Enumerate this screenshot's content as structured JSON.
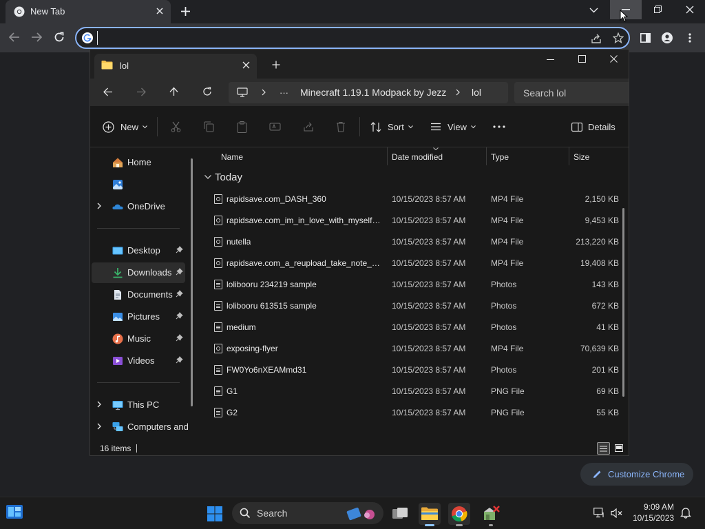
{
  "chrome": {
    "tab_title": "New Tab",
    "omnibox_value": "",
    "customize_label": "Customize Chrome"
  },
  "explorer": {
    "tab_title": "lol",
    "breadcrumb": [
      "Minecraft 1.19.1 Modpack by Jezz",
      "lol"
    ],
    "search_placeholder": "Search lol",
    "commands": {
      "new": "New",
      "sort": "Sort",
      "view": "View",
      "details": "Details"
    },
    "nav": {
      "home": "Home",
      "onedrive": "OneDrive",
      "desktop": "Desktop",
      "downloads": "Downloads",
      "documents": "Documents",
      "pictures": "Pictures",
      "music": "Music",
      "videos": "Videos",
      "this_pc": "This PC",
      "computers": "Computers and"
    },
    "columns": {
      "name": "Name",
      "date": "Date modified",
      "type": "Type",
      "size": "Size"
    },
    "group": "Today",
    "files": [
      {
        "name": "rapidsave.com_DASH_360",
        "date": "10/15/2023 8:57 AM",
        "type": "MP4 File",
        "size": "2,150 KB",
        "kind": "video"
      },
      {
        "name": "rapidsave.com_im_in_love_with_myself-...",
        "date": "10/15/2023 8:57 AM",
        "type": "MP4 File",
        "size": "9,453 KB",
        "kind": "video"
      },
      {
        "name": "nutella",
        "date": "10/15/2023 8:57 AM",
        "type": "MP4 File",
        "size": "213,220 KB",
        "kind": "video"
      },
      {
        "name": "rapidsave.com_a_reupload_take_note_thi...",
        "date": "10/15/2023 8:57 AM",
        "type": "MP4 File",
        "size": "19,408 KB",
        "kind": "video"
      },
      {
        "name": "lolibooru 234219 sample",
        "date": "10/15/2023 8:57 AM",
        "type": "Photos",
        "size": "143 KB",
        "kind": "image"
      },
      {
        "name": "lolibooru 613515 sample",
        "date": "10/15/2023 8:57 AM",
        "type": "Photos",
        "size": "672 KB",
        "kind": "image"
      },
      {
        "name": "medium",
        "date": "10/15/2023 8:57 AM",
        "type": "Photos",
        "size": "41 KB",
        "kind": "image"
      },
      {
        "name": "exposing-flyer",
        "date": "10/15/2023 8:57 AM",
        "type": "MP4 File",
        "size": "70,639 KB",
        "kind": "video"
      },
      {
        "name": "FW0Yo6nXEAMmd31",
        "date": "10/15/2023 8:57 AM",
        "type": "Photos",
        "size": "201 KB",
        "kind": "image"
      },
      {
        "name": "G1",
        "date": "10/15/2023 8:57 AM",
        "type": "PNG File",
        "size": "69 KB",
        "kind": "image"
      },
      {
        "name": "G2",
        "date": "10/15/2023 8:57 AM",
        "type": "PNG File",
        "size": "55 KB",
        "kind": "image"
      }
    ],
    "status_items": "16 items"
  },
  "taskbar": {
    "search_label": "Search",
    "time": "9:09 AM",
    "date": "10/15/2023"
  },
  "colors": {
    "accent": "#8ab4f8",
    "folder": "#f3c14b",
    "win_blue": "#0078d4"
  }
}
